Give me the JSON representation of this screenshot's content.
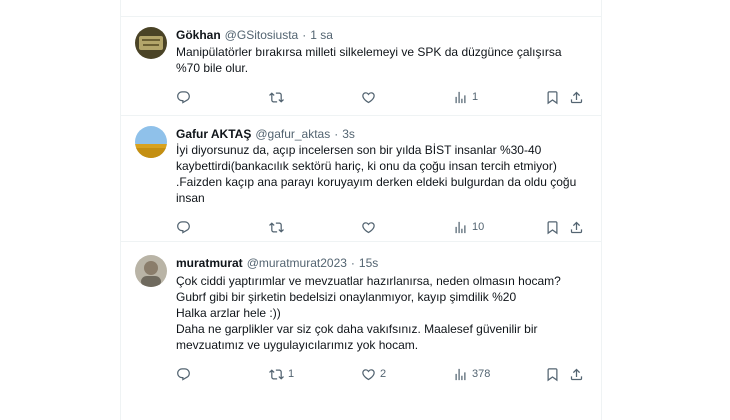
{
  "tweets": [
    {
      "name": "Gökhan",
      "handle": "@GSitosiusta",
      "time": "1 sa",
      "lines": [
        "Manipülatörler bırakırsa milleti silkelemeyi ve SPK da düzgünce çalışırsa",
        "%70 bile olur."
      ],
      "counts": {
        "reply": "",
        "retweet": "",
        "like": "",
        "views": "1"
      }
    },
    {
      "name": "Gafur AKTAŞ",
      "handle": "@gafur_aktas",
      "time": "3s",
      "lines": [
        "İyi diyorsunuz da, açıp incelersen son bir yılda BİST insanlar %30-40",
        "kaybettirdi(bankacılık sektörü hariç, ki onu da çoğu insan tercih etmiyor)",
        ".Faizden kaçıp ana parayı koruyayım derken eldeki bulgurdan da oldu çoğu",
        "insan"
      ],
      "counts": {
        "reply": "",
        "retweet": "",
        "like": "",
        "views": "10"
      }
    },
    {
      "name": "muratmurat",
      "handle": "@muratmurat2023",
      "time": "15s",
      "lines": [
        "Çok ciddi yaptırımlar ve mevzuatlar hazırlanırsa, neden olmasın hocam?",
        "Gubrf gibi bir şirketin bedelsizi onaylanmıyor, kayıp şimdilik %20",
        "Halka arzlar hele :))",
        "Daha ne garplikler var siz çok daha vakıfsınız. Maalesef güvenilir bir",
        "mevzuatımız ve uygulayıcılarımız yok hocam."
      ],
      "counts": {
        "reply": "",
        "retweet": "1",
        "like": "2",
        "views": "378"
      }
    }
  ],
  "meta_separator": "·",
  "icons": {
    "reply": "reply-icon",
    "retweet": "retweet-icon",
    "like": "heart-icon",
    "views": "views-chart-icon",
    "bookmark": "bookmark-icon",
    "share": "share-icon"
  },
  "colors": {
    "text": "#0f1419",
    "secondary": "#536471",
    "border": "#eff3f4"
  }
}
